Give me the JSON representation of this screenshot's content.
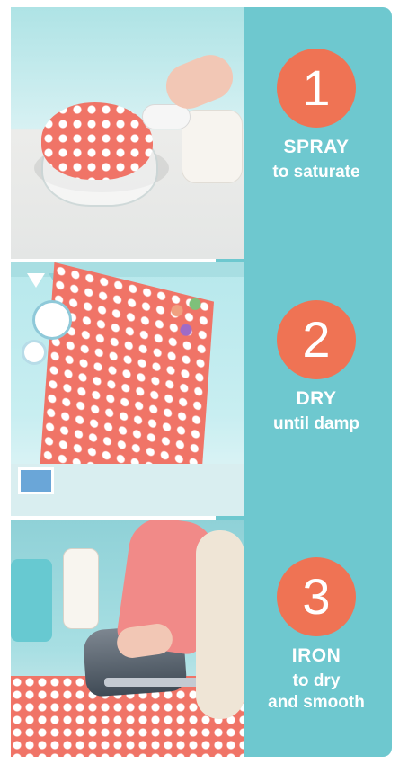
{
  "colors": {
    "accent_orange": "#ef7354",
    "teal_panel": "#6ec8cf",
    "text_white": "#ffffff"
  },
  "steps": [
    {
      "number": "1",
      "title": "SPRAY",
      "subtitle": "to saturate"
    },
    {
      "number": "2",
      "title": "DRY",
      "subtitle": "until damp"
    },
    {
      "number": "3",
      "title": "IRON",
      "subtitle": "to dry\nand smooth"
    }
  ]
}
